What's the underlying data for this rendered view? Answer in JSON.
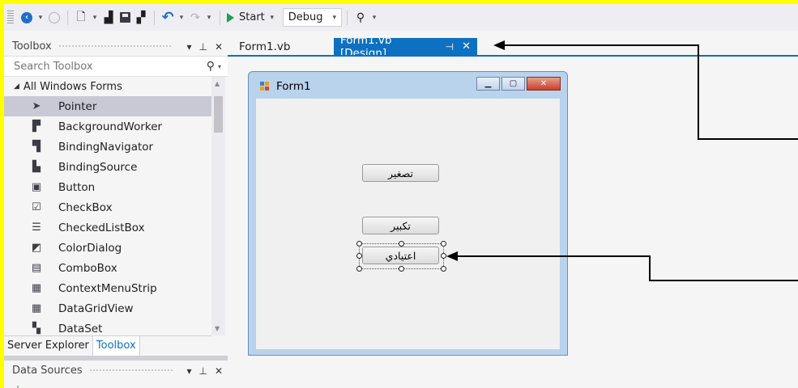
{
  "colors": {
    "highlight": "#ffff00",
    "accent": "#0e70c0",
    "run_green": "#1aa14d"
  },
  "toolbar": {
    "icons": [
      "back-icon",
      "forward-icon",
      "new-project-icon",
      "open-icon",
      "save-icon",
      "save-all-icon",
      "undo-icon",
      "redo-icon",
      "start-icon",
      "find-icon"
    ],
    "start_label": "Start",
    "config_value": "Debug"
  },
  "toolbox": {
    "title": "Toolbox",
    "search_placeholder": "Search Toolbox",
    "group_label": "All Windows Forms",
    "items": [
      {
        "label": "Pointer",
        "icon": "pointer-icon"
      },
      {
        "label": "BackgroundWorker",
        "icon": "backgroundworker-icon"
      },
      {
        "label": "BindingNavigator",
        "icon": "bindingnavigator-icon"
      },
      {
        "label": "BindingSource",
        "icon": "bindingsource-icon"
      },
      {
        "label": "Button",
        "icon": "button-icon"
      },
      {
        "label": "CheckBox",
        "icon": "checkbox-icon"
      },
      {
        "label": "CheckedListBox",
        "icon": "checkedlistbox-icon"
      },
      {
        "label": "ColorDialog",
        "icon": "colordialog-icon"
      },
      {
        "label": "ComboBox",
        "icon": "combobox-icon"
      },
      {
        "label": "ContextMenuStrip",
        "icon": "contextmenustrip-icon"
      },
      {
        "label": "DataGridView",
        "icon": "datagridview-icon"
      },
      {
        "label": "DataSet",
        "icon": "dataset-icon"
      }
    ],
    "selected_index": 0
  },
  "bottom_tabs": {
    "server_explorer": "Server Explorer",
    "toolbox": "Toolbox"
  },
  "data_sources": {
    "title": "Data Sources"
  },
  "doc_tabs": {
    "tab1": "Form1.vb",
    "tab2": "Form1.vb [Design]"
  },
  "form": {
    "title": "Form1",
    "buttons": [
      {
        "label": "تصغير"
      },
      {
        "label": "تكبير"
      },
      {
        "label": "اعتيادي"
      }
    ]
  }
}
